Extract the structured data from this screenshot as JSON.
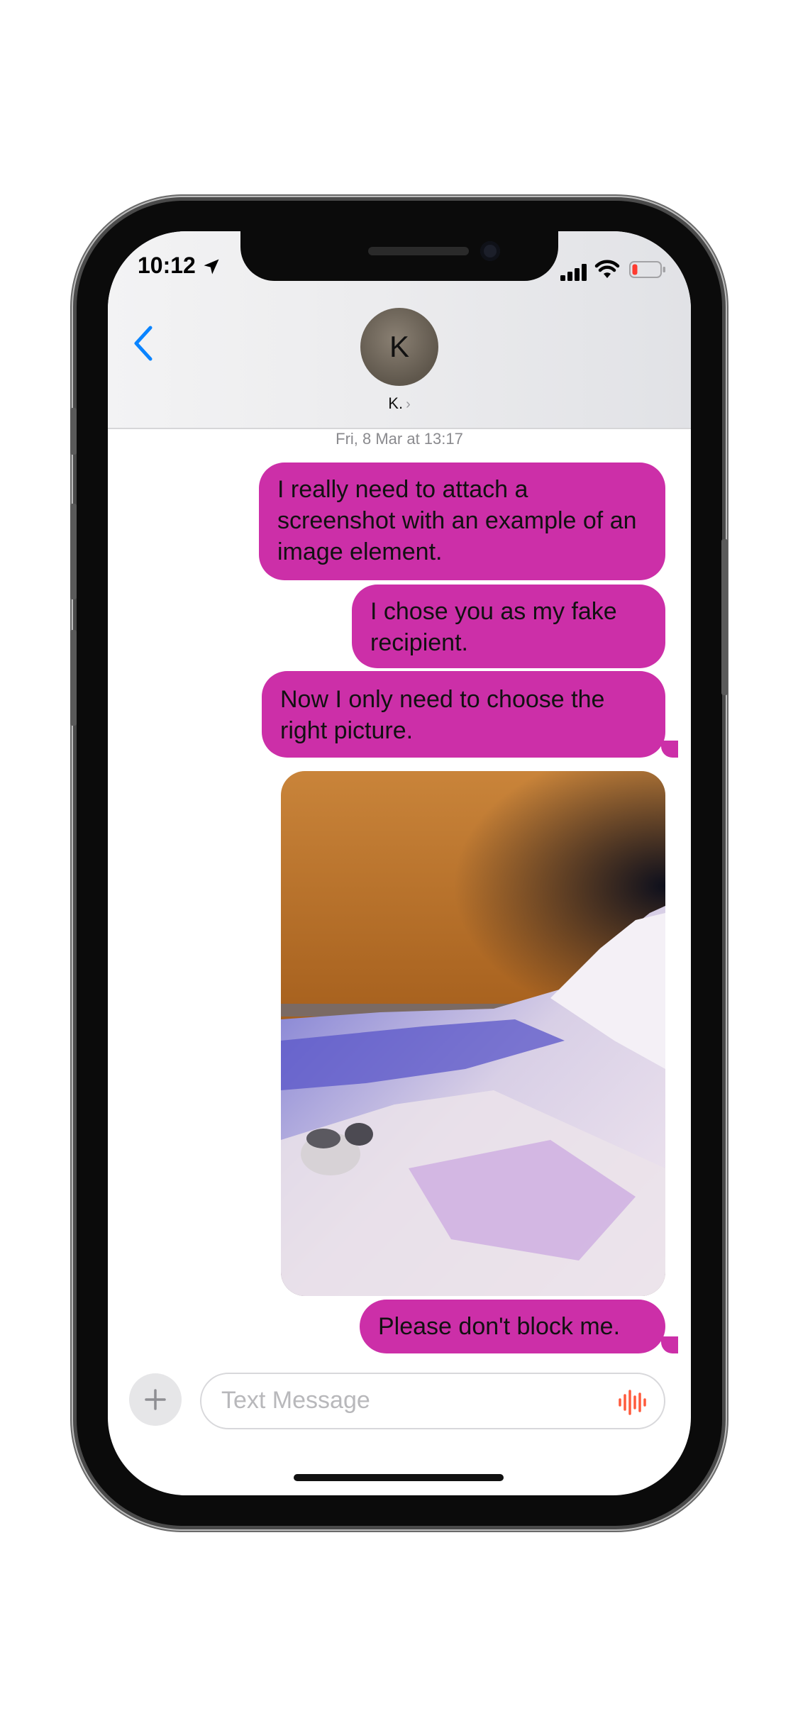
{
  "status": {
    "time": "10:12"
  },
  "header": {
    "avatar_initial": "K",
    "contact_name": "K.",
    "contact_chevron": "›"
  },
  "thread": {
    "timestamp": "Fri, 8 Mar at 13:17",
    "messages": [
      "I really need to attach a screenshot with an example of an image element.",
      "I chose you as my fake recipient.",
      "Now I only need to choose the right picture.",
      "Please don't block me."
    ]
  },
  "composer": {
    "placeholder": "Text Message"
  },
  "colors": {
    "bubble": "#cc2fa8",
    "accent_blue": "#0a84ff",
    "audio_icon": "#ff3b30"
  },
  "icons": [
    "back-chevron-icon",
    "location-arrow-icon",
    "cellular-signal-icon",
    "wifi-icon",
    "battery-icon",
    "plus-icon",
    "audio-waveform-icon"
  ]
}
